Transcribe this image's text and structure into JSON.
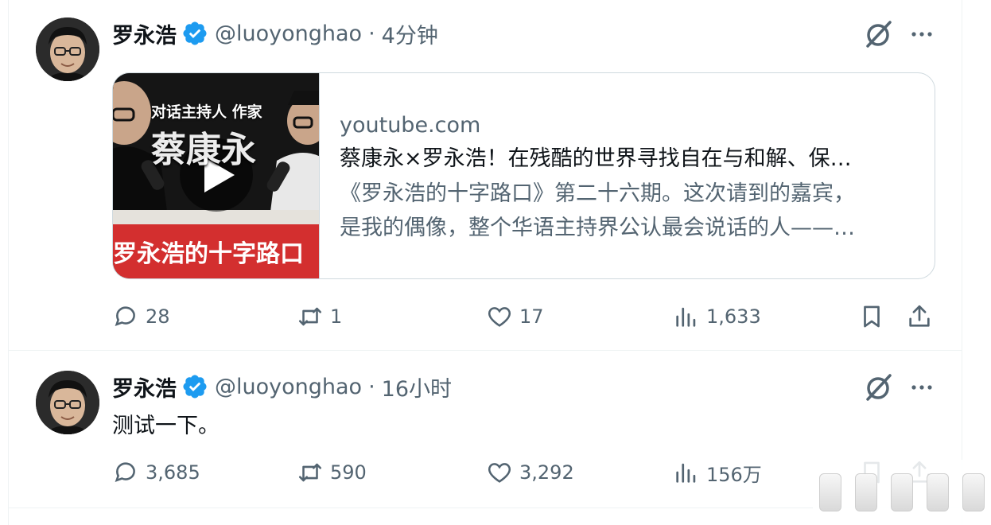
{
  "tweets": [
    {
      "name": "罗永浩",
      "handle": "@luoyonghao",
      "dot": "·",
      "time": "4分钟",
      "card": {
        "thumb_top_text": "对话主持人 作家",
        "thumb_big_text": "蔡康永",
        "thumb_bottom_text": "罗永浩的十字路口",
        "domain": "youtube.com",
        "title": "蔡康永×罗永浩！在残酷的世界寻找自在与和解、保…",
        "desc_line1": "《罗永浩的十字路口》第二十六期。这次请到的嘉宾，",
        "desc_line2": "是我的偶像，整个华语主持界公认最会说话的人——…"
      },
      "stats": {
        "replies": "28",
        "retweets": "1",
        "likes": "17",
        "views": "1,633"
      }
    },
    {
      "name": "罗永浩",
      "handle": "@luoyonghao",
      "dot": "·",
      "time": "16小时",
      "text": "测试一下。",
      "stats": {
        "replies": "3,685",
        "retweets": "590",
        "likes": "3,292",
        "views": "156万"
      }
    }
  ],
  "colors": {
    "verified": "#1d9bf0",
    "secondary": "#536471",
    "primary": "#0f1419",
    "thumb_red": "#d32f2f"
  },
  "icons": [
    "verified-badge-icon",
    "grok-icon",
    "more-icon",
    "reply-icon",
    "retweet-icon",
    "like-icon",
    "views-icon",
    "bookmark-icon",
    "share-icon",
    "play-icon"
  ]
}
